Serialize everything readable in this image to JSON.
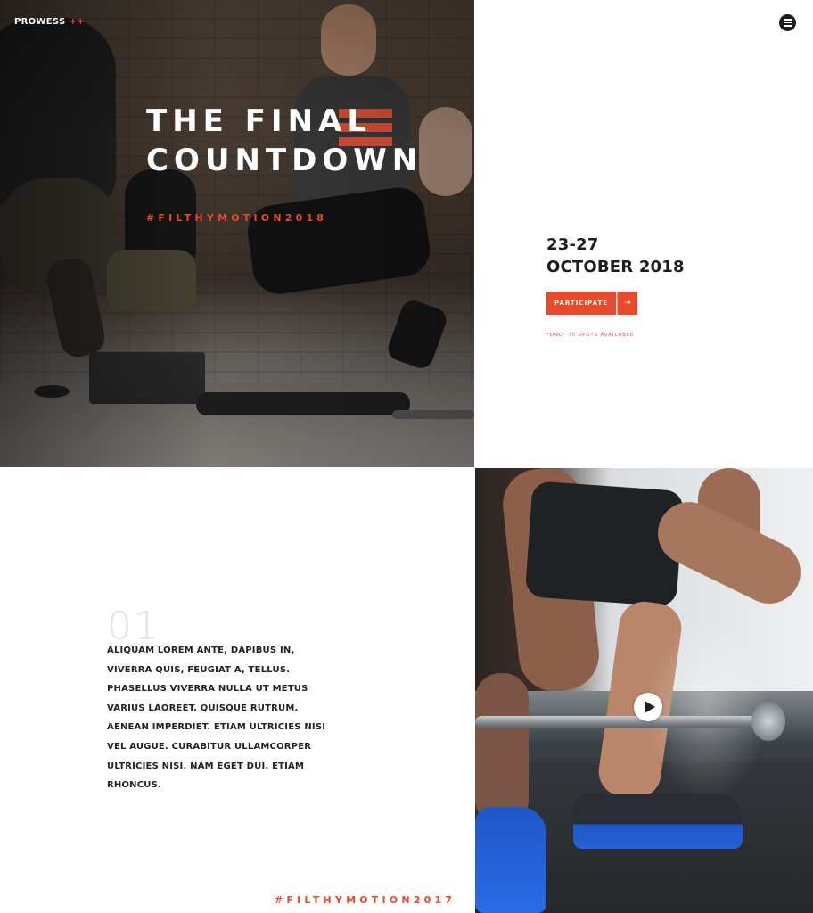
{
  "header": {
    "brand_name": "PROWESS",
    "brand_mark": "++",
    "menu_icon": "hamburger-menu-icon"
  },
  "hero": {
    "title_line1": "THE FINAL",
    "title_line2": "COUNTDOWN",
    "hashtag": "#FILTHYMOTION2018"
  },
  "event": {
    "date_line1": "23-27",
    "date_line2": "OCTOBER 2018",
    "cta_label": "PARTICIPATE",
    "cta_arrow": "→",
    "note": "*ONLY 70 SPOTS AVAILABLE"
  },
  "section": {
    "number": "01",
    "body": "ALIQUAM LOREM ANTE, DAPIBUS IN, VIVERRA QUIS, FEUGIAT A, TELLUS. PHASELLUS VIVERRA NULLA UT METUS VARIUS LAOREET. QUISQUE RUTRUM. AENEAN IMPERDIET. ETIAM ULTRICIES NISI VEL AUGUE. CURABITUR ULLAMCORPER ULTRICIES NISI. NAM EGET DUI. ETIAM RHONCUS.",
    "footer_hashtag": "#FILTHYMOTION2017"
  },
  "video": {
    "play_icon": "play-icon"
  },
  "colors": {
    "accent": "#e84a2c",
    "text_dark": "#1d1d1d",
    "background": "#ffffff"
  }
}
